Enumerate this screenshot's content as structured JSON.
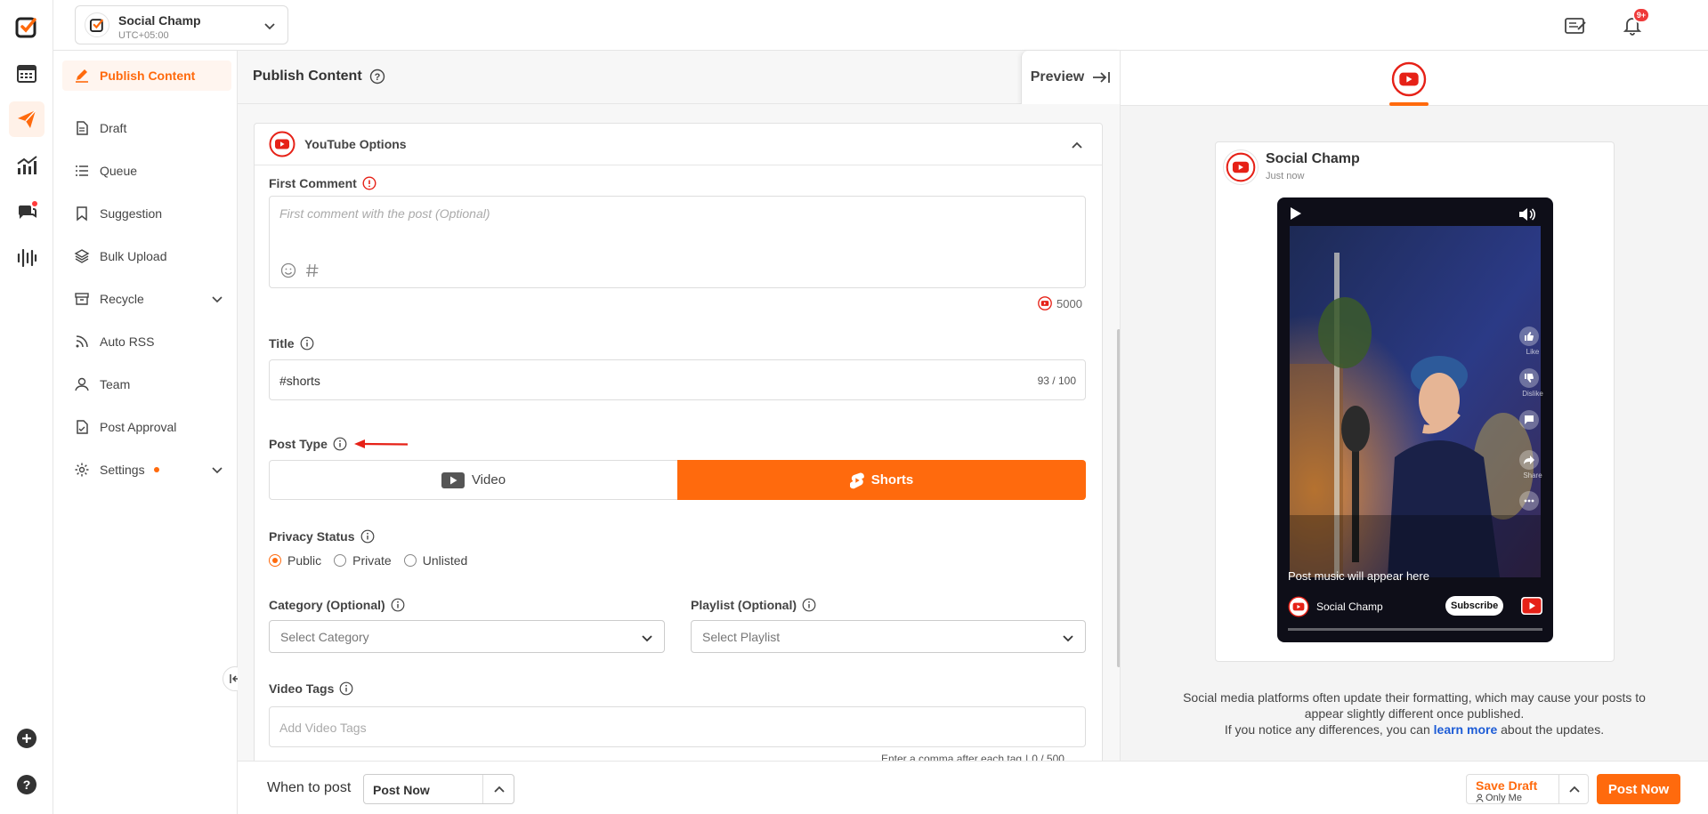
{
  "account": {
    "name": "Social Champ",
    "timezone": "UTC+05:00"
  },
  "header": {
    "notification_badge": "9+"
  },
  "sidebar": {
    "items": [
      {
        "label": "Publish Content"
      },
      {
        "label": "Draft"
      },
      {
        "label": "Queue"
      },
      {
        "label": "Suggestion"
      },
      {
        "label": "Bulk Upload"
      },
      {
        "label": "Recycle"
      },
      {
        "label": "Auto RSS"
      },
      {
        "label": "Team"
      },
      {
        "label": "Post Approval"
      },
      {
        "label": "Settings"
      }
    ]
  },
  "main": {
    "title": "Publish Content",
    "preview_label": "Preview"
  },
  "youtube_options": {
    "title": "YouTube Options",
    "first_comment": {
      "label": "First Comment",
      "placeholder": "First comment with the post (Optional)",
      "char_limit": "5000"
    },
    "title_field": {
      "label": "Title",
      "value": "#shorts",
      "counter": "93 / 100"
    },
    "post_type": {
      "label": "Post Type",
      "options": [
        "Video",
        "Shorts"
      ],
      "selected": "Shorts"
    },
    "privacy_status": {
      "label": "Privacy Status",
      "options": [
        "Public",
        "Private",
        "Unlisted"
      ],
      "selected": "Public"
    },
    "category": {
      "label": "Category (Optional)",
      "placeholder": "Select Category"
    },
    "playlist": {
      "label": "Playlist (Optional)",
      "placeholder": "Select Playlist"
    },
    "video_tags": {
      "label": "Video Tags",
      "placeholder": "Add Video Tags",
      "hint": "Enter a comma after each tag",
      "counter": "0 / 500"
    }
  },
  "bottom_bar": {
    "when_label": "When to post",
    "when_value": "Post Now",
    "save_draft": "Save Draft",
    "save_scope": "Only Me",
    "post_now": "Post Now"
  },
  "preview": {
    "channel_name": "Social Champ",
    "time": "Just now",
    "music_text": "Post music will appear here",
    "channel_label": "Social Champ",
    "subscribe": "Subscribe",
    "side_actions": [
      "Like",
      "Dislike",
      "Share"
    ],
    "notice_line1": "Social media platforms often update their formatting, which may cause your posts to appear slightly different once published.",
    "notice_line2_prefix": "If you notice any differences, you can",
    "notice_link": "learn more",
    "notice_line2_suffix": "about the updates."
  },
  "colors": {
    "accent": "#ff6a0d",
    "youtube_red": "#e62117",
    "link": "#1d5cd6"
  }
}
